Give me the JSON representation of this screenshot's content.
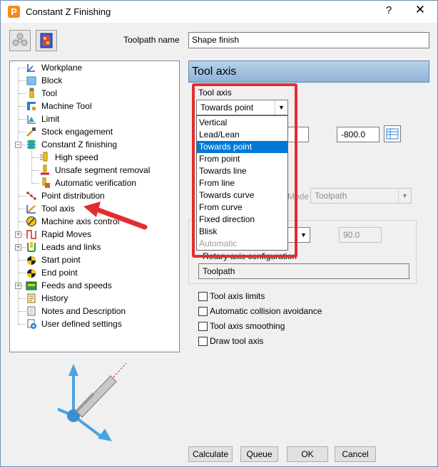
{
  "window": {
    "title": "Constant Z Finishing",
    "help": "?",
    "close": "✕"
  },
  "toolbar": {
    "icon1": "toolpath-reuse-icon",
    "icon2": "thumbnail-icon"
  },
  "toolpath_name": {
    "label": "Toolpath name",
    "value": "Shape finish"
  },
  "tree": {
    "items": [
      {
        "label": "Workplane",
        "icon": "workplane-icon"
      },
      {
        "label": "Block",
        "icon": "block-icon"
      },
      {
        "label": "Tool",
        "icon": "tool-icon"
      },
      {
        "label": "Machine Tool",
        "icon": "machine-tool-icon"
      },
      {
        "label": "Limit",
        "icon": "limit-icon"
      },
      {
        "label": "Stock engagement",
        "icon": "stock-engagement-icon"
      },
      {
        "label": "Constant Z finishing",
        "icon": "constant-z-icon"
      },
      {
        "label": "High speed",
        "icon": "high-speed-icon"
      },
      {
        "label": "Unsafe segment removal",
        "icon": "unsafe-segment-icon"
      },
      {
        "label": "Automatic verification",
        "icon": "automatic-verification-icon"
      },
      {
        "label": "Point distribution",
        "icon": "point-distribution-icon"
      },
      {
        "label": "Tool axis",
        "icon": "tool-axis-icon"
      },
      {
        "label": "Machine axis control",
        "icon": "machine-axis-icon"
      },
      {
        "label": "Rapid Moves",
        "icon": "rapid-moves-icon"
      },
      {
        "label": "Leads and links",
        "icon": "leads-links-icon"
      },
      {
        "label": "Start point",
        "icon": "start-point-icon"
      },
      {
        "label": "End point",
        "icon": "end-point-icon"
      },
      {
        "label": "Feeds and speeds",
        "icon": "feeds-speeds-icon"
      },
      {
        "label": "History",
        "icon": "history-icon"
      },
      {
        "label": "Notes and Description",
        "icon": "notes-icon"
      },
      {
        "label": "User defined settings",
        "icon": "user-settings-icon"
      }
    ]
  },
  "panel": {
    "title": "Tool axis",
    "tool_axis_label": "Tool axis",
    "tool_axis_value": "Towards point",
    "coord_value": "-800.0",
    "mode_label": "Mode",
    "mode_value": "Toolpath",
    "angle_value": "90.0",
    "rotary_label": "Rotary axis configuration",
    "rotary_value": "Toolpath"
  },
  "dropdown": {
    "options": [
      "Vertical",
      "Lead/Lean",
      "Towards point",
      "From point",
      "Towards line",
      "From line",
      "Towards curve",
      "From curve",
      "Fixed direction",
      "Blisk",
      "Automatic"
    ],
    "selected": "Towards point",
    "disabled": [
      "Automatic"
    ]
  },
  "checkboxes": [
    {
      "label": "Tool axis limits",
      "checked": false
    },
    {
      "label": "Automatic collision avoidance",
      "checked": false
    },
    {
      "label": "Tool axis smoothing",
      "checked": false
    },
    {
      "label": "Draw tool axis",
      "checked": false
    }
  ],
  "buttons": {
    "calculate": "Calculate",
    "queue": "Queue",
    "ok": "OK",
    "cancel": "Cancel"
  },
  "colors": {
    "highlight_red": "#e32d2d",
    "selection_blue": "#0078d7",
    "header_blue": "#8fb2d6"
  }
}
